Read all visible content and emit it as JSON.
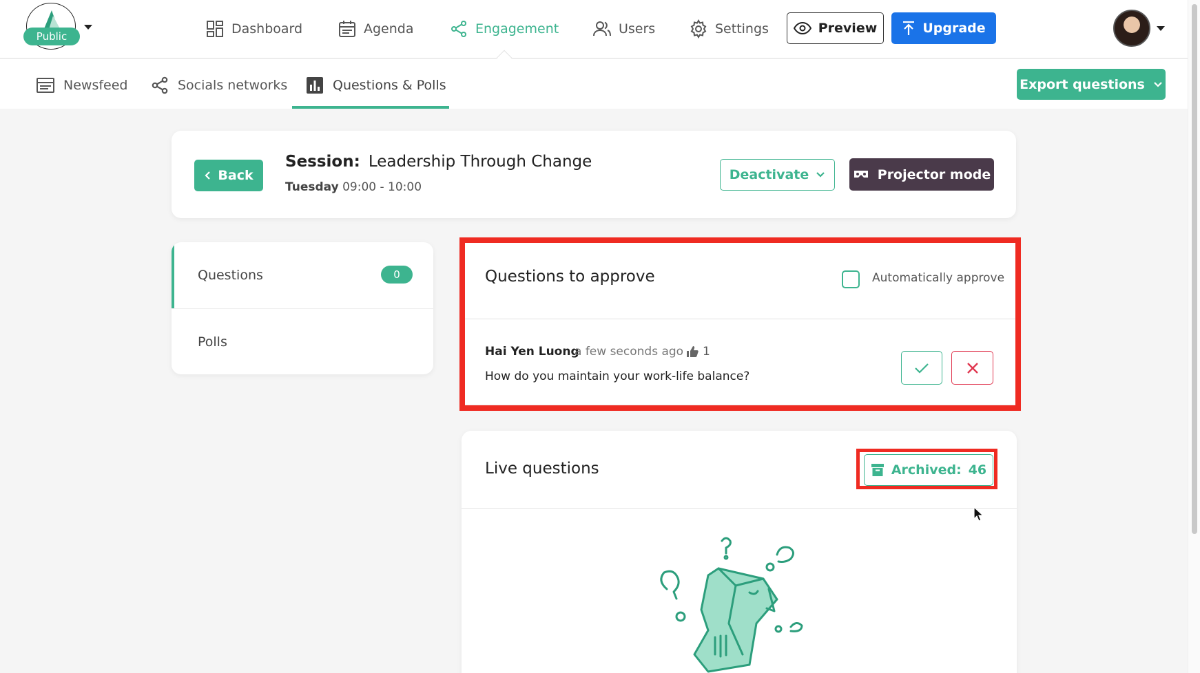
{
  "brand": {
    "badge": "Public"
  },
  "nav": {
    "items": [
      {
        "label": "Dashboard",
        "icon": "dashboard-icon"
      },
      {
        "label": "Agenda",
        "icon": "calendar-icon"
      },
      {
        "label": "Engagement",
        "icon": "share-icon",
        "active": true
      },
      {
        "label": "Users",
        "icon": "users-icon"
      },
      {
        "label": "Settings",
        "icon": "gear-icon"
      }
    ],
    "preview_label": "Preview",
    "upgrade_label": "Upgrade"
  },
  "subnav": {
    "items": [
      {
        "label": "Newsfeed",
        "icon": "newsfeed-icon"
      },
      {
        "label": "Socials networks",
        "icon": "share-icon"
      },
      {
        "label": "Questions & Polls",
        "icon": "bar-chart-icon",
        "active": true
      }
    ],
    "export_label": "Export questions"
  },
  "session": {
    "back_label": "Back",
    "prefix": "Session:",
    "title": "Leadership Through Change",
    "day": "Tuesday",
    "time": "09:00 - 10:00",
    "deactivate_label": "Deactivate",
    "projector_label": "Projector mode"
  },
  "sidebar": {
    "items": [
      {
        "label": "Questions",
        "count": "0"
      },
      {
        "label": "Polls"
      }
    ]
  },
  "approve": {
    "title": "Questions to approve",
    "auto_label": "Automatically approve",
    "question": {
      "author": "Hai Yen Luong",
      "time": "a few seconds ago",
      "likes": "1",
      "text": "How do you maintain your work-life balance?"
    }
  },
  "live": {
    "title": "Live questions",
    "archived_label": "Archived:",
    "archived_count": "46"
  },
  "colors": {
    "accent": "#3db48f",
    "primary": "#1a73e8",
    "projector": "#4a3a4a",
    "reject": "#e0364f",
    "highlight": "#ef2b22"
  }
}
